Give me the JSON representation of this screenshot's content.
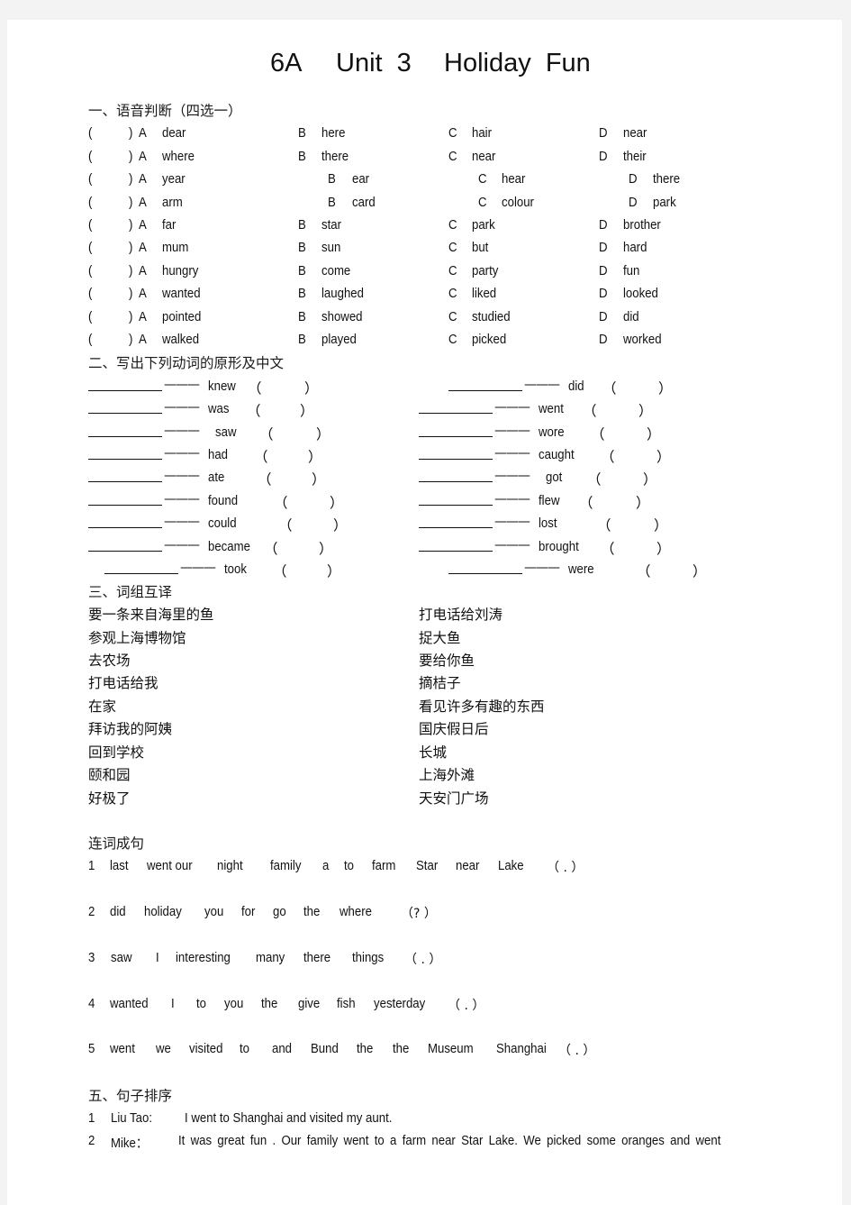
{
  "title": {
    "grade": "6A",
    "unit": "Unit  3",
    "name": "Holiday  Fun"
  },
  "section1": {
    "heading": "一、语音判断（四选一）",
    "paren_open": "(",
    "paren_close": ")",
    "rows": [
      {
        "A": "dear",
        "B": "here",
        "C": "hair",
        "D": "near"
      },
      {
        "A": "where",
        "B": "there",
        "C": "near",
        "D": "their"
      },
      {
        "A": "year",
        "B": "ear",
        "C": "hear",
        "D": "there"
      },
      {
        "A": "arm",
        "B": "card",
        "C": "colour",
        "D": "park"
      },
      {
        "A": "far",
        "B": "star",
        "C": "park",
        "D": "brother"
      },
      {
        "A": "mum",
        "B": "sun",
        "C": "but",
        "D": "hard"
      },
      {
        "A": "hungry",
        "B": "come",
        "C": "party",
        "D": "fun"
      },
      {
        "A": "wanted",
        "B": "laughed",
        "C": "liked",
        "D": "looked"
      },
      {
        "A": "pointed",
        "B": "showed",
        "C": "studied",
        "D": "did"
      },
      {
        "A": "walked",
        "B": "played",
        "C": "picked",
        "D": "worked"
      }
    ],
    "letters": {
      "A": "A",
      "B": "B",
      "C": "C",
      "D": "D"
    }
  },
  "section2": {
    "heading": "二、写出下列动词的原形及中文",
    "dash": "———",
    "paren_open": "（",
    "paren_close": "）",
    "left": [
      "knew",
      "was",
      "saw",
      "had",
      "ate",
      "found",
      "could",
      "became",
      "took"
    ],
    "right": [
      "did",
      "went",
      "wore",
      "caught",
      "got",
      "flew",
      "lost",
      "brought",
      "were"
    ]
  },
  "section3": {
    "heading": "三、词组互译",
    "left": [
      "要一条来自海里的鱼",
      "参观上海博物馆",
      "去农场",
      "打电话给我",
      "在家",
      "拜访我的阿姨",
      "回到学校",
      "颐和园",
      "好极了"
    ],
    "right": [
      "打电话给刘涛",
      "捉大鱼",
      "要给你鱼",
      "摘桔子",
      "看见许多有趣的东西",
      "国庆假日后",
      "长城",
      "上海外滩",
      "天安门广场"
    ]
  },
  "section4": {
    "heading": "连词成句",
    "items": [
      {
        "num": "1",
        "words": [
          "last",
          "went our",
          "night",
          "family",
          "a",
          "to",
          "farm",
          "Star",
          "near",
          "Lake"
        ],
        "punct": "（ . ）"
      },
      {
        "num": "2",
        "words": [
          "did",
          "holiday",
          "you",
          "for",
          "go",
          "the",
          "where"
        ],
        "punct": "（? ）"
      },
      {
        "num": "3",
        "words": [
          "saw",
          "I",
          "interesting",
          "many",
          "there",
          "things"
        ],
        "punct": "（ . ）"
      },
      {
        "num": "4",
        "words": [
          "wanted",
          "I",
          "to",
          "you",
          "the",
          "give",
          "fish",
          "yesterday"
        ],
        "punct": "（ . ）"
      },
      {
        "num": "5",
        "words": [
          "went",
          "we",
          "visited",
          "to",
          "and",
          "Bund",
          "the",
          "the",
          "Museum",
          "Shanghai"
        ],
        "punct": "（ . ）"
      }
    ]
  },
  "section5": {
    "heading": "五、句子排序",
    "items": [
      {
        "num": "1",
        "speaker": "Liu Tao:",
        "text": "I went to Shanghai and visited my aunt."
      },
      {
        "num": "2",
        "speaker": "Mike：",
        "text": "It was great fun . Our family went to a farm near Star Lake. We picked some oranges and went"
      }
    ]
  }
}
